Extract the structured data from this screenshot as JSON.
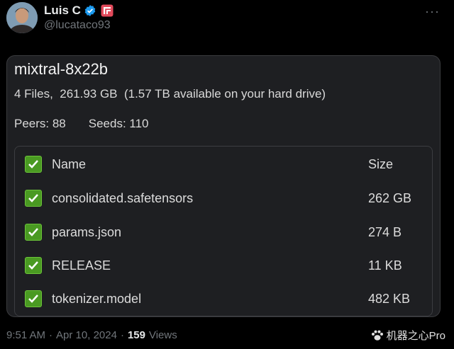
{
  "author": {
    "display_name": "Luis C",
    "handle": "@lucataco93"
  },
  "more_glyph": "···",
  "card": {
    "title": "mixtral-8x22b",
    "files_summary": "4 Files,  261.93 GB  (1.57 TB available on your hard drive)",
    "peers": "Peers: 88",
    "seeds": "Seeds: 110",
    "columns": {
      "name": "Name",
      "size": "Size"
    },
    "rows": [
      {
        "name": "consolidated.safetensors",
        "size": "262 GB"
      },
      {
        "name": "params.json",
        "size": "274 B"
      },
      {
        "name": "RELEASE",
        "size": "11 KB"
      },
      {
        "name": "tokenizer.model",
        "size": "482 KB"
      }
    ]
  },
  "meta": {
    "time": "9:51 AM",
    "sep1": "·",
    "date": "Apr 10, 2024",
    "sep2": "·",
    "views_count": "159",
    "views_label": "Views"
  },
  "watermark": "机器之心Pro",
  "colors": {
    "background": "#000000",
    "card": "#1e1f22",
    "checkbox_green": "#4a9a22",
    "verified_blue": "#1d9bf0",
    "muted_text": "#71767b"
  }
}
